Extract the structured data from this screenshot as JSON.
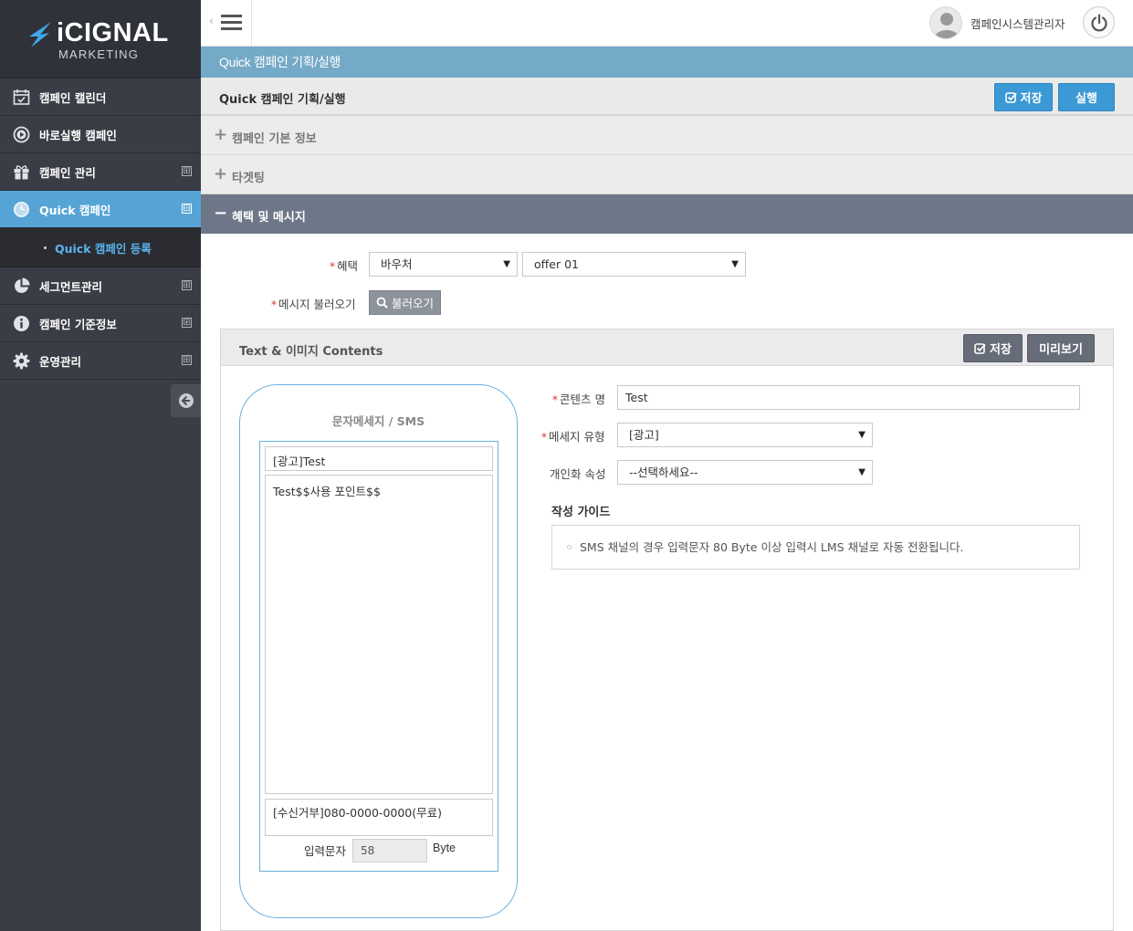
{
  "app": {
    "logo_text": "iCIGNAL",
    "logo_sub": "MARKETING",
    "brand_color": "#56a4d6"
  },
  "topbar": {
    "username": "캠페인시스템관리자"
  },
  "sidebar": {
    "items": [
      {
        "label": "캠페인 캘린더",
        "icon": "calendar-icon",
        "expandable": false
      },
      {
        "label": "바로실행 캠페인",
        "icon": "play-icon",
        "expandable": false
      },
      {
        "label": "캠페인 관리",
        "icon": "gift-icon",
        "expandable": true,
        "state": "⊞"
      },
      {
        "label": "Quick 캠페인",
        "icon": "clock-icon",
        "expandable": true,
        "state": "⊟",
        "active": true
      },
      {
        "label": "세그먼트관리",
        "icon": "pie-chart-icon",
        "expandable": true,
        "state": "⊞"
      },
      {
        "label": "캠페인 기준정보",
        "icon": "info-icon",
        "expandable": true,
        "state": "⊞"
      },
      {
        "label": "운영관리",
        "icon": "gear-icon",
        "expandable": true,
        "state": "⊞"
      }
    ],
    "submenu": {
      "label": "Quick 캠페인 등록"
    }
  },
  "page": {
    "header": "Quick 캠페인 기획/실행",
    "title": "Quick 캠페인 기획/실행",
    "save_label": "저장",
    "run_label": "실행"
  },
  "accordion": {
    "basic": "캠페인 기본 정보",
    "targeting": "타겟팅",
    "benefit": "혜택 및 메시지"
  },
  "benefit_form": {
    "benefit_label": "혜택",
    "benefit_type": "바우처",
    "benefit_offer": "offer 01",
    "msg_load_label": "메시지 불러오기",
    "load_button": "불러오기"
  },
  "contents": {
    "title": "Text & 이미지 Contents",
    "save_label": "저장",
    "preview_label": "미리보기",
    "phone_title": "문자메세지 / SMS",
    "subject": "[광고]Test",
    "body": "Test$$사용 포인트$$",
    "footer": "[수신거부]080-0000-0000(무료)",
    "input_chars_label": "입력문자",
    "byte_value": "58",
    "byte_unit": "Byte",
    "content_name_label": "콘텐츠 명",
    "content_name_value": "Test",
    "msg_type_label": "메세지 유형",
    "msg_type_value": "[광고]",
    "personal_label": "개인화 속성",
    "personal_value": "--선택하세요--",
    "guide_title": "작성 가이드",
    "guide_text": "SMS 채널의 경우 입력문자 80 Byte 이상 입력시 LMS 채널로 자동 전환됩니다."
  }
}
